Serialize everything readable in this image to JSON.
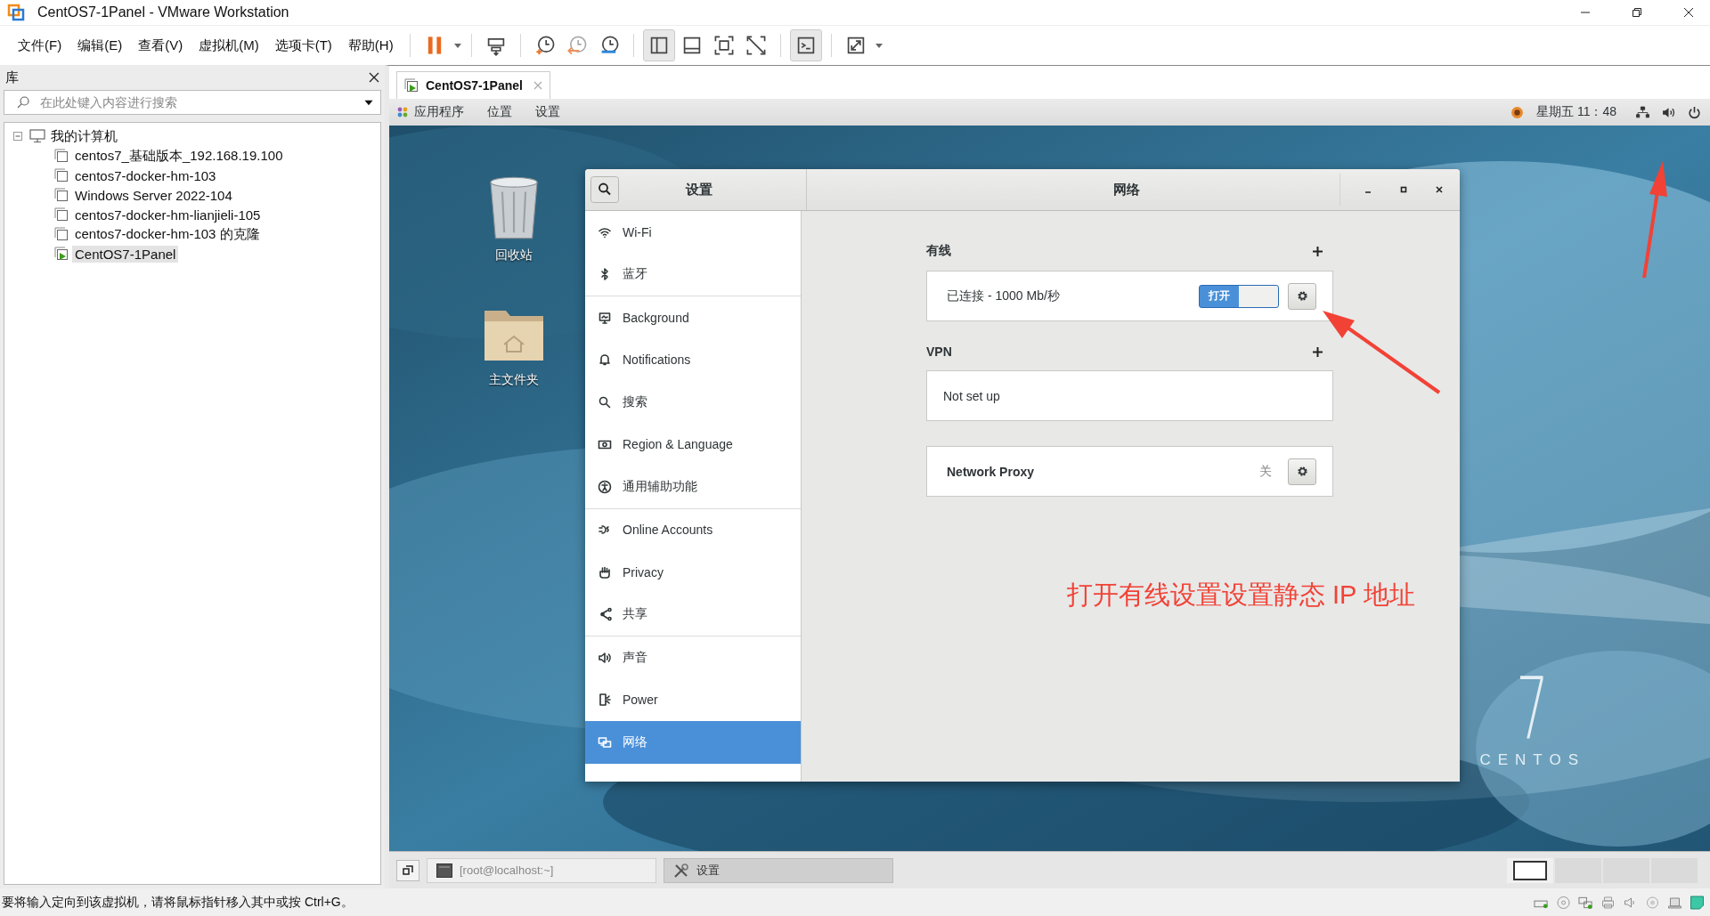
{
  "window": {
    "title": "CentOS7-1Panel - VMware Workstation"
  },
  "menu": [
    "文件(F)",
    "编辑(E)",
    "查看(V)",
    "虚拟机(M)",
    "选项卡(T)",
    "帮助(H)"
  ],
  "library": {
    "title": "库",
    "search": {
      "placeholder": "在此处键入内容进行搜索"
    },
    "tree": [
      {
        "label": "我的计算机",
        "expanded": true,
        "children": [
          {
            "label": "centos7_基础版本_192.168.19.100",
            "running": false,
            "selected": false
          },
          {
            "label": "centos7-docker-hm-103",
            "running": false,
            "selected": false
          },
          {
            "label": "Windows Server 2022-104",
            "running": false,
            "selected": false
          },
          {
            "label": "centos7-docker-hm-lianjieli-105",
            "running": false,
            "selected": false
          },
          {
            "label": "centos7-docker-hm-103 的克隆",
            "running": false,
            "selected": false
          },
          {
            "label": "CentOS7-1Panel",
            "running": true,
            "selected": true
          }
        ]
      }
    ]
  },
  "vm_tabs": [
    {
      "label": "CentOS7-1Panel",
      "selected": true
    }
  ],
  "guest_panel": {
    "menus": [
      "应用程序",
      "位置",
      "设置"
    ],
    "clock": "星期五 11：48"
  },
  "desktop_icons": [
    {
      "label": "回收站",
      "kind": "trash"
    },
    {
      "label": "主文件夹",
      "kind": "folder"
    }
  ],
  "wallpaper_logo": {
    "numeral": "7",
    "name": "CENTOS"
  },
  "settings": {
    "title": "设置",
    "page_title": "网络",
    "sidebar": [
      [
        {
          "label": "Wi-Fi",
          "selected": false
        },
        {
          "label": "蓝牙",
          "selected": false
        }
      ],
      [
        {
          "label": "Background",
          "selected": false
        },
        {
          "label": "Notifications",
          "selected": false
        },
        {
          "label": "搜索",
          "selected": false
        },
        {
          "label": "Region & Language",
          "selected": false
        },
        {
          "label": "通用辅助功能",
          "selected": false
        }
      ],
      [
        {
          "label": "Online Accounts",
          "selected": false
        },
        {
          "label": "Privacy",
          "selected": false
        },
        {
          "label": "共享",
          "selected": false
        }
      ],
      [
        {
          "label": "声音",
          "selected": false
        },
        {
          "label": "Power",
          "selected": false
        },
        {
          "label": "网络",
          "selected": true
        }
      ]
    ],
    "wired": {
      "heading": "有线",
      "status": "已连接 - 1000 Mb/秒",
      "switch": {
        "label": "打开",
        "on": true
      }
    },
    "vpn": {
      "heading": "VPN",
      "status": "Not set up"
    },
    "proxy": {
      "label": "Network Proxy",
      "value": "关"
    }
  },
  "annotation": "打开有线设置设置静态 IP 地址",
  "taskbar": [
    {
      "label": "[root@localhost:~]",
      "selected": false
    },
    {
      "label": "设置",
      "selected": true
    }
  ],
  "workspaces": [
    {
      "selected": true
    },
    {
      "selected": false
    },
    {
      "selected": false
    },
    {
      "selected": false
    }
  ],
  "status_bar": "要将输入定向到该虚拟机，请将鼠标指针移入其中或按 Ctrl+G。"
}
